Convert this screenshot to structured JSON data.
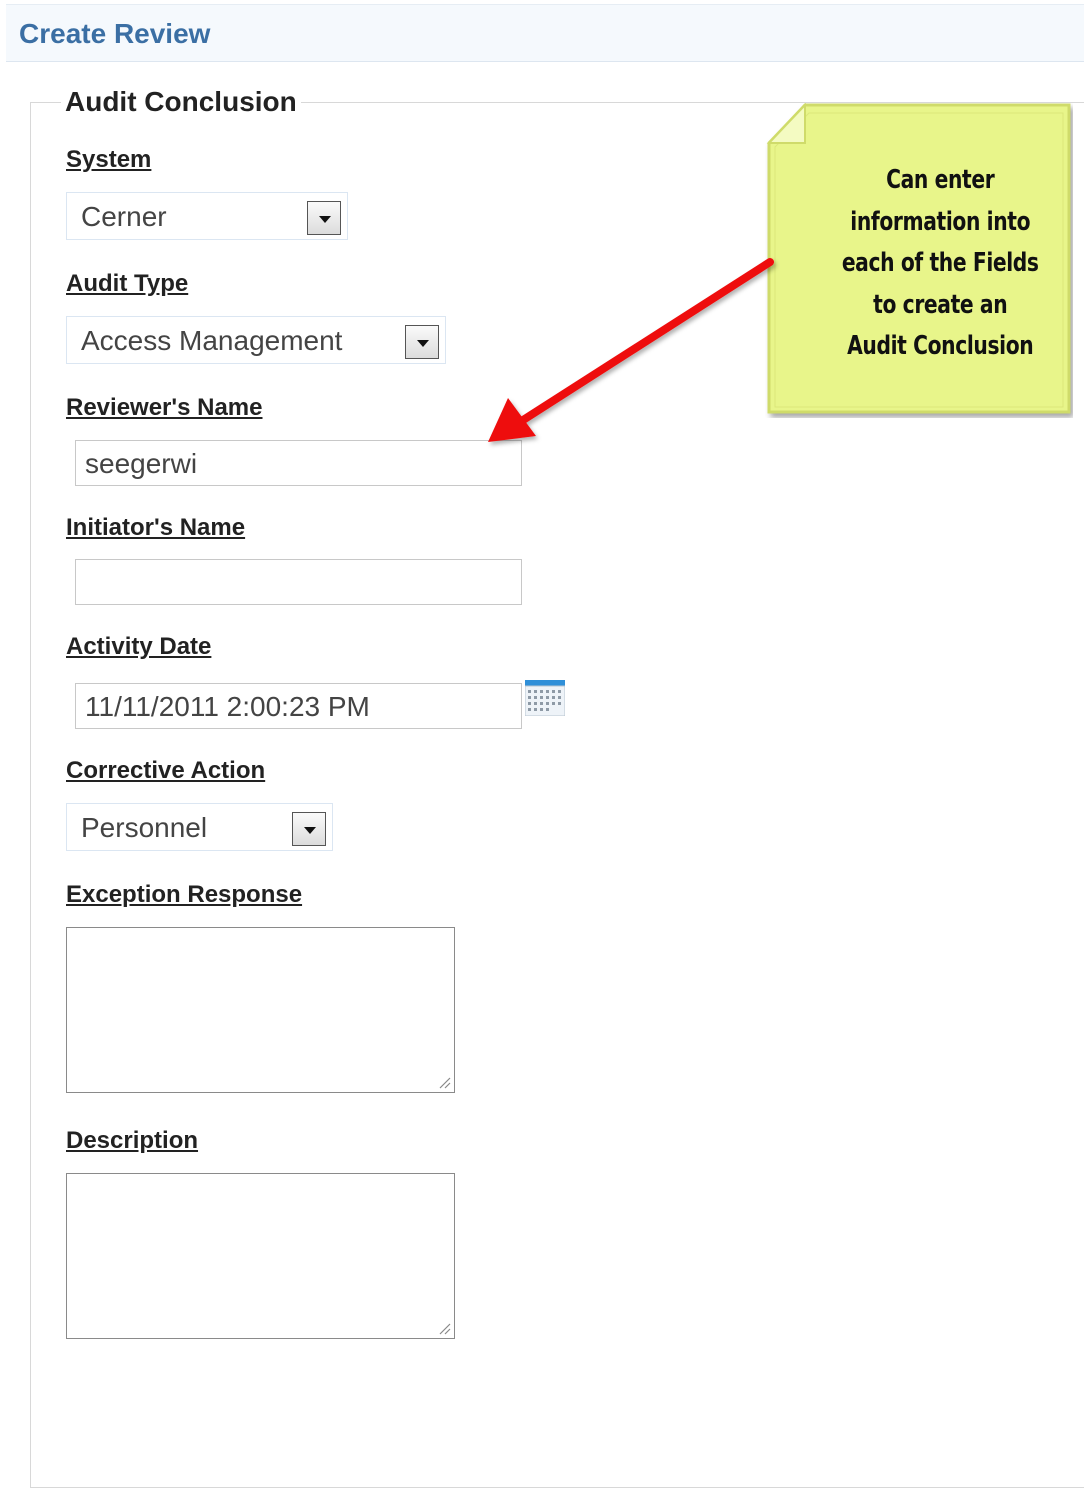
{
  "header": {
    "title": "Create Review"
  },
  "section": {
    "legend": "Audit Conclusion"
  },
  "fields": {
    "system": {
      "label": "System",
      "value": "Cerner"
    },
    "audit_type": {
      "label": "Audit Type",
      "value": "Access Management"
    },
    "reviewer_name": {
      "label": "Reviewer's Name",
      "value": "seegerwi"
    },
    "initiator_name": {
      "label": "Initiator's Name",
      "value": ""
    },
    "activity_date": {
      "label": "Activity Date",
      "value": "11/11/2011 2:00:23 PM"
    },
    "corrective_action": {
      "label": "Corrective Action",
      "value": "Personnel"
    },
    "exception_response": {
      "label": "Exception Response",
      "value": ""
    },
    "description": {
      "label": "Description",
      "value": ""
    }
  },
  "annotation": {
    "text": "Can enter\ninformation into\neach of the Fields\nto create an\nAudit Conclusion",
    "note_color": "#e8f58a",
    "arrow_color": "#ee1111"
  },
  "icons": {
    "dropdown": "chevron-down-icon",
    "calendar": "calendar-icon",
    "resize": "resize-handle-icon"
  }
}
